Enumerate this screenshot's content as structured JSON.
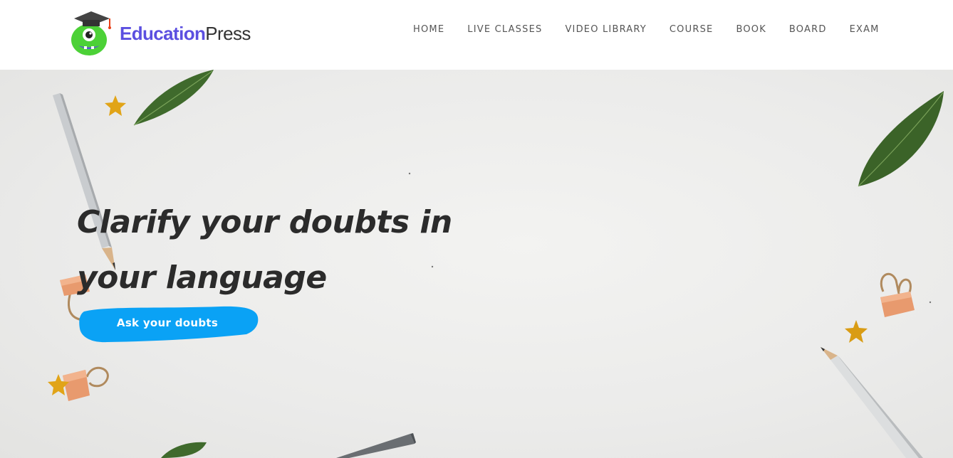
{
  "brand": {
    "name_bold": "Education",
    "name_light": "Press",
    "colors": {
      "primary": "#5b4fe0",
      "mascot": "#4cd137",
      "cta": "#0aa2f5"
    }
  },
  "nav": {
    "items": [
      {
        "label": "HOME"
      },
      {
        "label": "LIVE CLASSES"
      },
      {
        "label": "VIDEO LIBRARY"
      },
      {
        "label": "COURSE"
      },
      {
        "label": "BOOK"
      },
      {
        "label": "BOARD"
      },
      {
        "label": "EXAM"
      }
    ]
  },
  "hero": {
    "title_line1": "Clarify your doubts in",
    "title_line2": "your language",
    "cta_label": "Ask your doubts"
  },
  "icons": [
    "mascot-logo-icon",
    "pencil-icon",
    "leaf-icon",
    "star-icon",
    "binder-clip-icon"
  ]
}
